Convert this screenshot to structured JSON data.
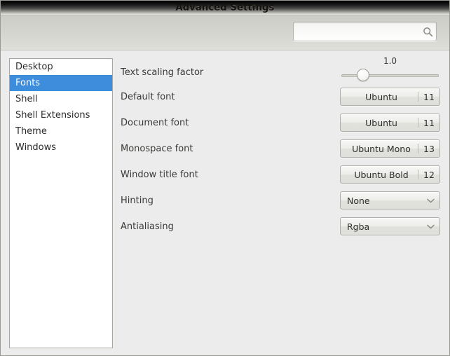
{
  "window": {
    "title": "Advanced Settings"
  },
  "toolbar": {
    "search": {
      "value": "",
      "placeholder": "",
      "icon": "search-icon"
    }
  },
  "sidebar": {
    "items": [
      {
        "label": "Desktop",
        "selected": false
      },
      {
        "label": "Fonts",
        "selected": true
      },
      {
        "label": "Shell",
        "selected": false
      },
      {
        "label": "Shell Extensions",
        "selected": false
      },
      {
        "label": "Theme",
        "selected": false
      },
      {
        "label": "Windows",
        "selected": false
      }
    ],
    "selected_color": "#3e8ddd"
  },
  "settings": {
    "text_scaling": {
      "label": "Text scaling factor",
      "value": "1.0",
      "handle_position_percent": 23
    },
    "default_font": {
      "label": "Default font",
      "font_name": "Ubuntu",
      "font_size": "11"
    },
    "document_font": {
      "label": "Document font",
      "font_name": "Ubuntu",
      "font_size": "11"
    },
    "monospace_font": {
      "label": "Monospace font",
      "font_name": "Ubuntu Mono",
      "font_size": "13"
    },
    "window_title_font": {
      "label": "Window title font",
      "font_name": "Ubuntu Bold",
      "font_size": "12"
    },
    "hinting": {
      "label": "Hinting",
      "value": "None",
      "icon": "chevron-down-icon"
    },
    "antialiasing": {
      "label": "Antialiasing",
      "value": "Rgba",
      "icon": "chevron-down-icon"
    }
  }
}
